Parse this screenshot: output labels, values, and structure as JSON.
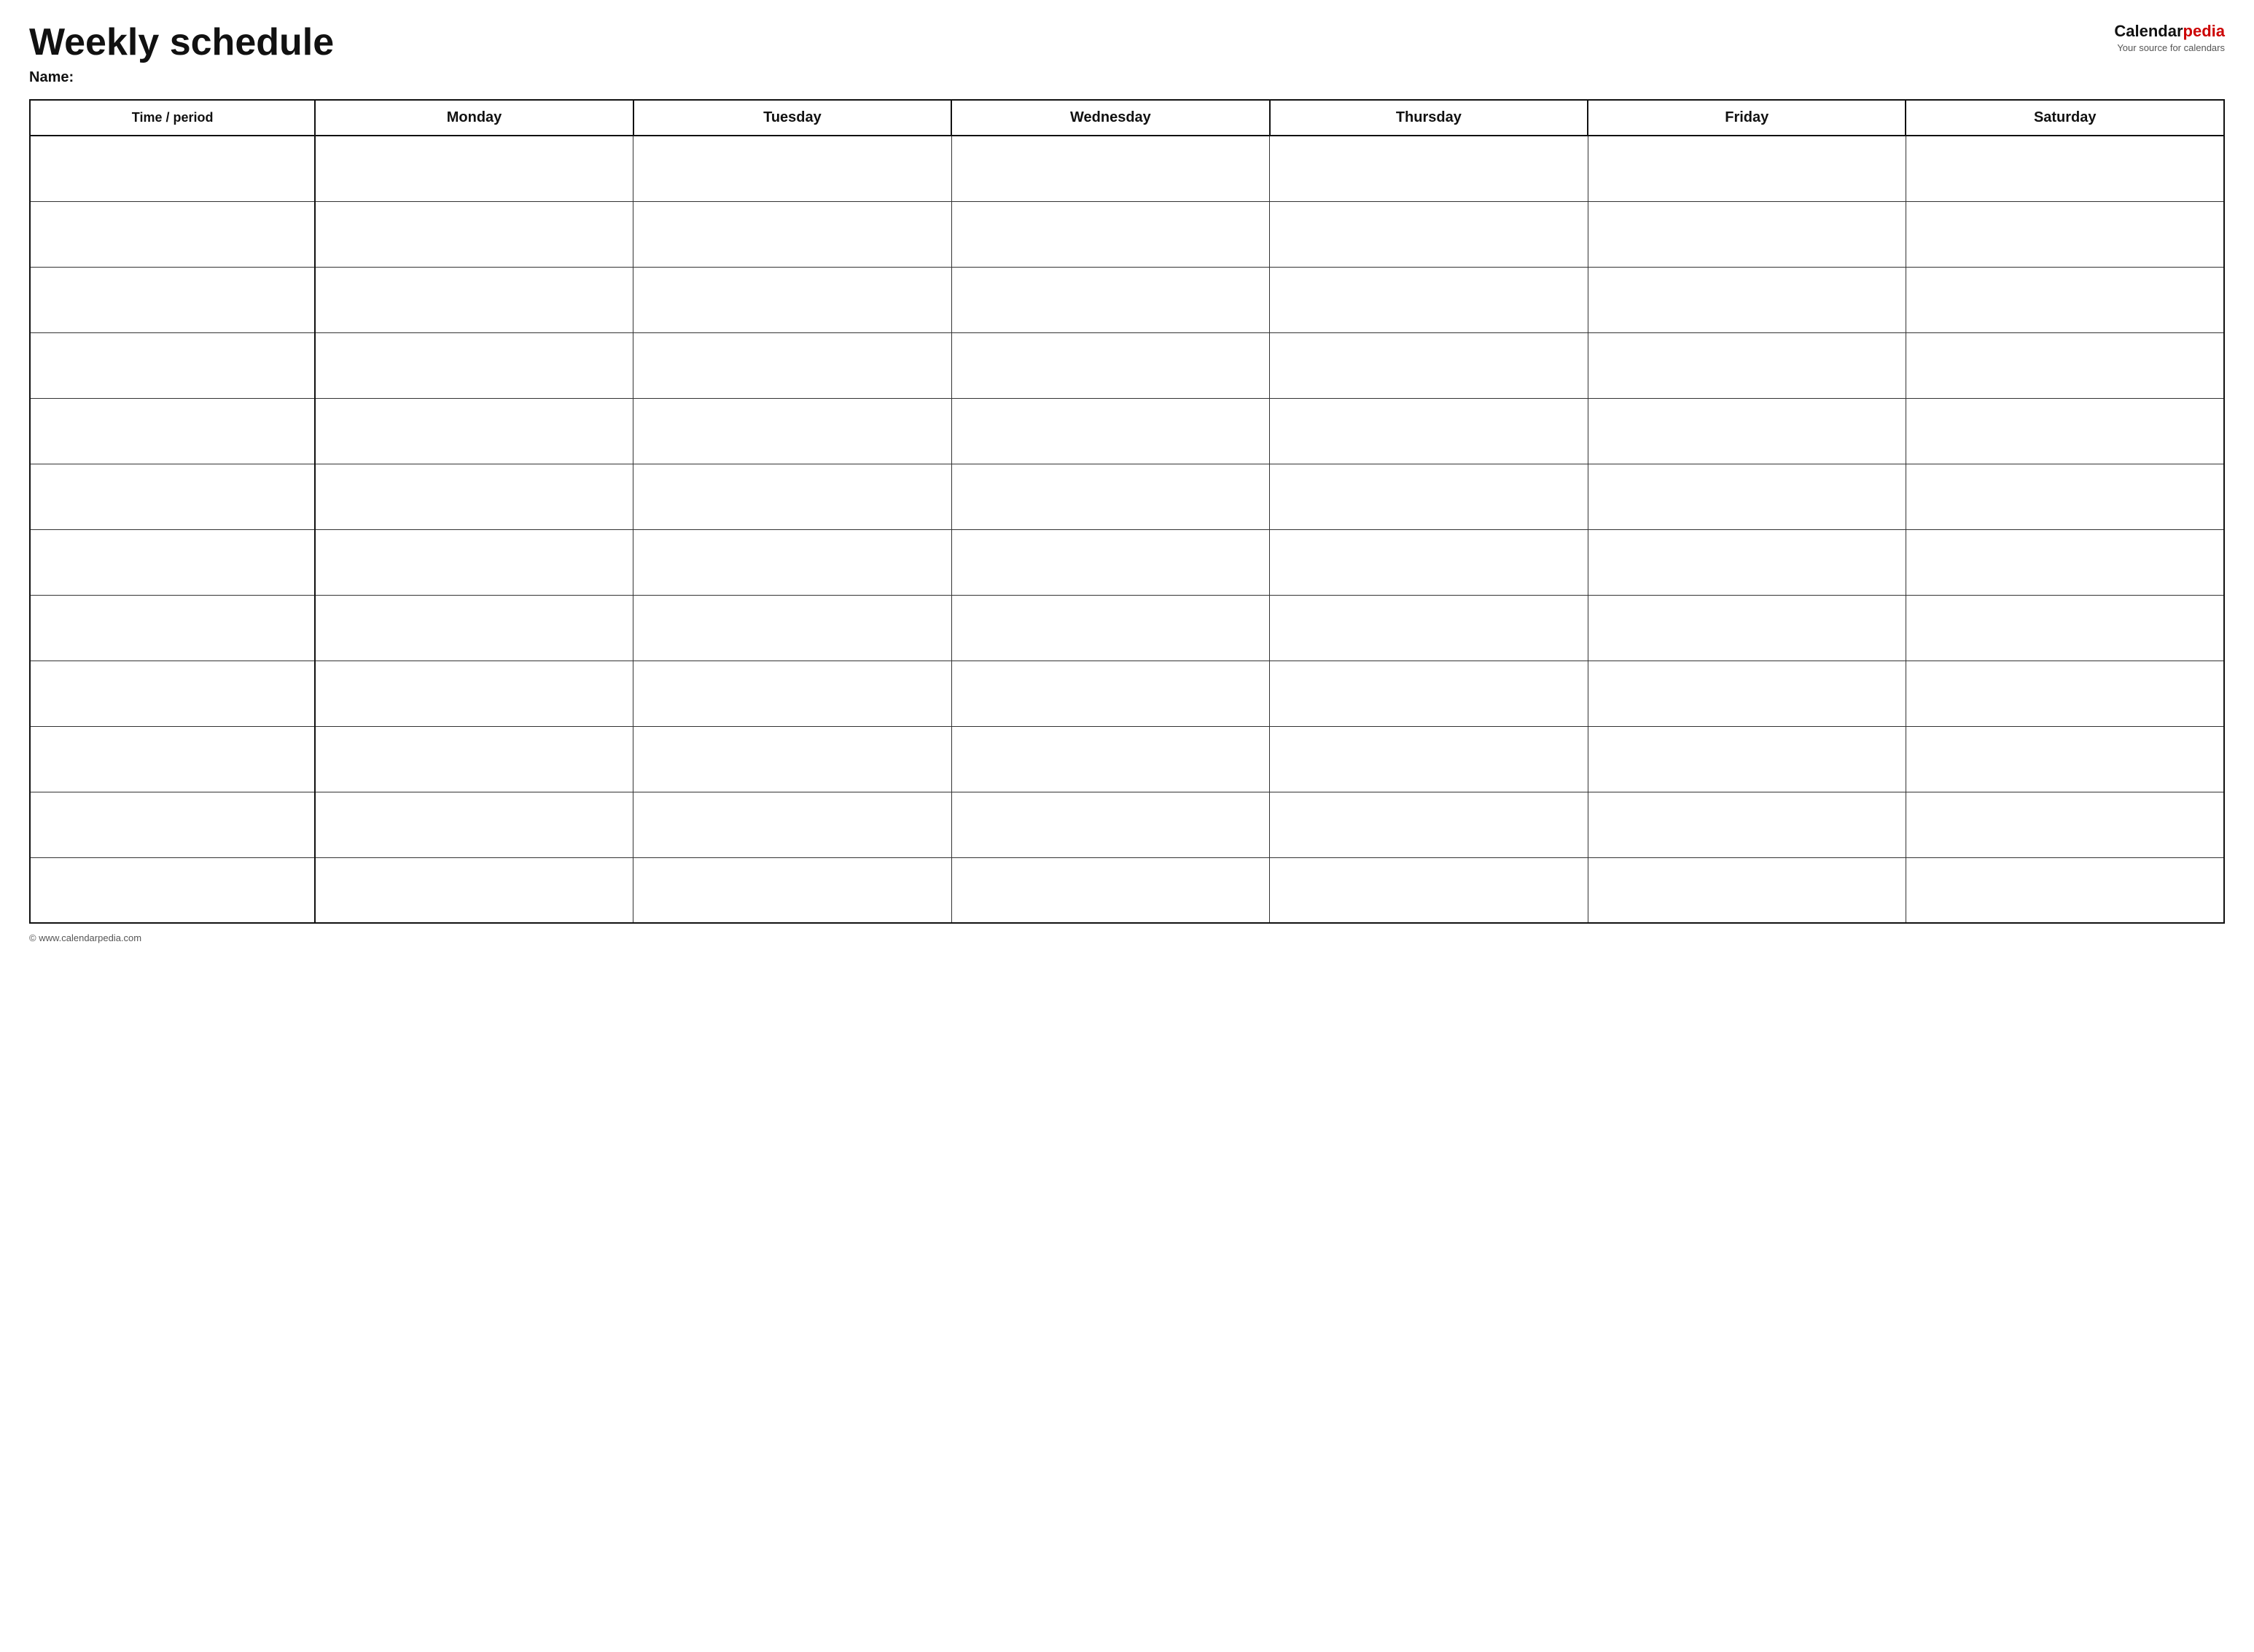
{
  "header": {
    "title": "Weekly schedule",
    "name_label": "Name:",
    "logo": {
      "calendar_text": "Calendar",
      "pedia_text": "pedia",
      "tagline": "Your source for calendars"
    }
  },
  "table": {
    "columns": [
      {
        "key": "time",
        "label": "Time / period"
      },
      {
        "key": "monday",
        "label": "Monday"
      },
      {
        "key": "tuesday",
        "label": "Tuesday"
      },
      {
        "key": "wednesday",
        "label": "Wednesday"
      },
      {
        "key": "thursday",
        "label": "Thursday"
      },
      {
        "key": "friday",
        "label": "Friday"
      },
      {
        "key": "saturday",
        "label": "Saturday"
      }
    ],
    "row_count": 12
  },
  "footer": {
    "copyright": "© www.calendarpedia.com"
  }
}
